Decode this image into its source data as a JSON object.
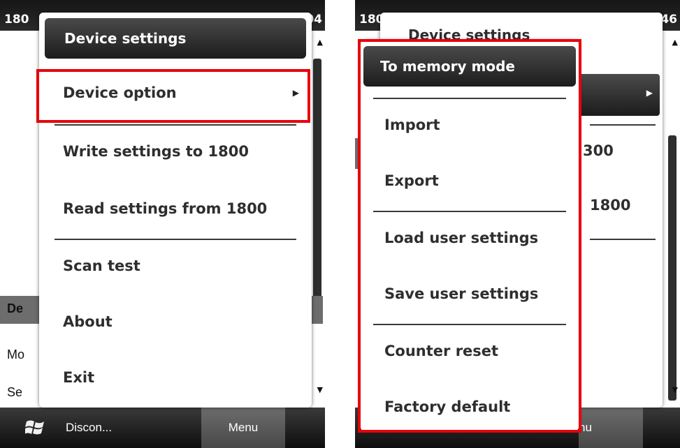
{
  "left_screen": {
    "title_left": "180",
    "title_right": "04",
    "background_section": "De",
    "background_rows": [
      "Mo",
      "Se"
    ],
    "bottom_bar": {
      "left_softkey": "Discon...",
      "right_softkey": "Menu"
    },
    "menu": {
      "header": "Device settings",
      "items": [
        "Device option",
        "Write settings to 1800",
        "Read settings from 1800",
        "Scan test",
        "About",
        "Exit"
      ]
    }
  },
  "right_screen": {
    "title_left": "180",
    "title_right": "46",
    "parent_menu": {
      "header": "Device settings",
      "partial_items": [
        "300",
        "1800"
      ]
    },
    "bottom_bar": {
      "right_softkey_partial": "nu"
    },
    "submenu": {
      "header": "To memory mode",
      "items": [
        "Import",
        "Export",
        "Load user settings",
        "Save user settings",
        "Counter reset",
        "Factory default"
      ]
    }
  },
  "colors": {
    "highlight": "#e8000b",
    "title_bar": "#161616",
    "menu_header": "#2a2a2a",
    "menu_text": "#2e2e2e"
  },
  "icons": [
    "windows-start-icon",
    "submenu-arrow-icon",
    "scroll-up-icon",
    "scroll-down-icon"
  ]
}
